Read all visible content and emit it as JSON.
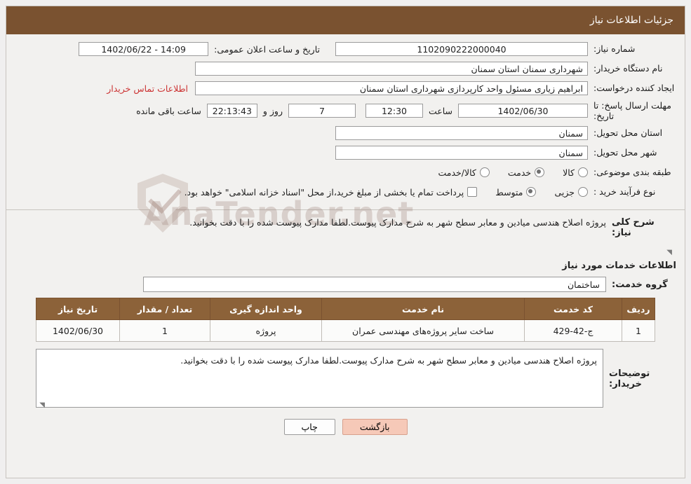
{
  "header": {
    "title": "جزئیات اطلاعات نیاز"
  },
  "watermark": {
    "text": "AnaTender.net",
    "icon": "shield-check-icon"
  },
  "info": {
    "need_number_label": "شماره نیاز:",
    "need_number_value": "1102090222000040",
    "announce_datetime_label": "تاریخ و ساعت اعلان عمومی:",
    "announce_datetime_value": "14:09 - 1402/06/22",
    "buyer_org_label": "نام دستگاه خریدار:",
    "buyer_org_value": "شهرداری سمنان استان سمنان",
    "requester_label": "ایجاد کننده درخواست:",
    "requester_value": "ابراهیم زیاری مسئول واحد کارپردازی شهرداری استان سمنان",
    "contact_link": "اطلاعات تماس خریدار",
    "deadline_label": "مهلت ارسال پاسخ: تا تاریخ:",
    "deadline_date": "1402/06/30",
    "deadline_hour_label": "ساعت",
    "deadline_hour": "12:30",
    "remaining_days": "7",
    "remaining_days_label": "روز و",
    "remaining_time": "22:13:43",
    "remaining_suffix": "ساعت باقی مانده",
    "province_label": "استان محل تحویل:",
    "province_value": "سمنان",
    "city_label": "شهر محل تحویل:",
    "city_value": "سمنان",
    "category_label": "طبقه بندی موضوعی:",
    "category_options": [
      {
        "label": "کالا",
        "selected": false
      },
      {
        "label": "خدمت",
        "selected": true
      },
      {
        "label": "کالا/خدمت",
        "selected": false
      }
    ],
    "process_label": "نوع فرآیند خرید :",
    "process_options": [
      {
        "label": "جزیی",
        "selected": false
      },
      {
        "label": "متوسط",
        "selected": true
      }
    ],
    "process_note": "پرداخت تمام یا بخشی از مبلغ خرید،از محل \"اسناد خزانه اسلامی\" خواهد بود."
  },
  "description": {
    "label": "شرح کلی نیاز:",
    "text": "پروژه اصلاح هندسی میادین و معابر سطح شهر به شرح مدارک پیوست.لطفا مدارک پیوست شده را با دقت بخوانید."
  },
  "services": {
    "heading": "اطلاعات خدمات مورد نیاز",
    "group_label": "گروه خدمت:",
    "group_value": "ساختمان",
    "table": {
      "headers": [
        "ردیف",
        "کد خدمت",
        "نام خدمت",
        "واحد اندازه گیری",
        "تعداد / مقدار",
        "تاریخ نیاز"
      ],
      "rows": [
        {
          "row_no": "1",
          "service_code": "ج-42-429",
          "service_name": "ساخت سایر پروژه‌های مهندسی عمران",
          "unit": "پروژه",
          "quantity": "1",
          "need_date": "1402/06/30"
        }
      ]
    }
  },
  "buyer_notes": {
    "label": "توضیحات خریدار:",
    "text": "پروژه اصلاح هندسی میادین و معابر سطح شهر به شرح مدارک پیوست.لطفا مدارک پیوست شده را با دقت بخوانید."
  },
  "footer": {
    "print_label": "چاپ",
    "back_label": "بازگشت"
  }
}
